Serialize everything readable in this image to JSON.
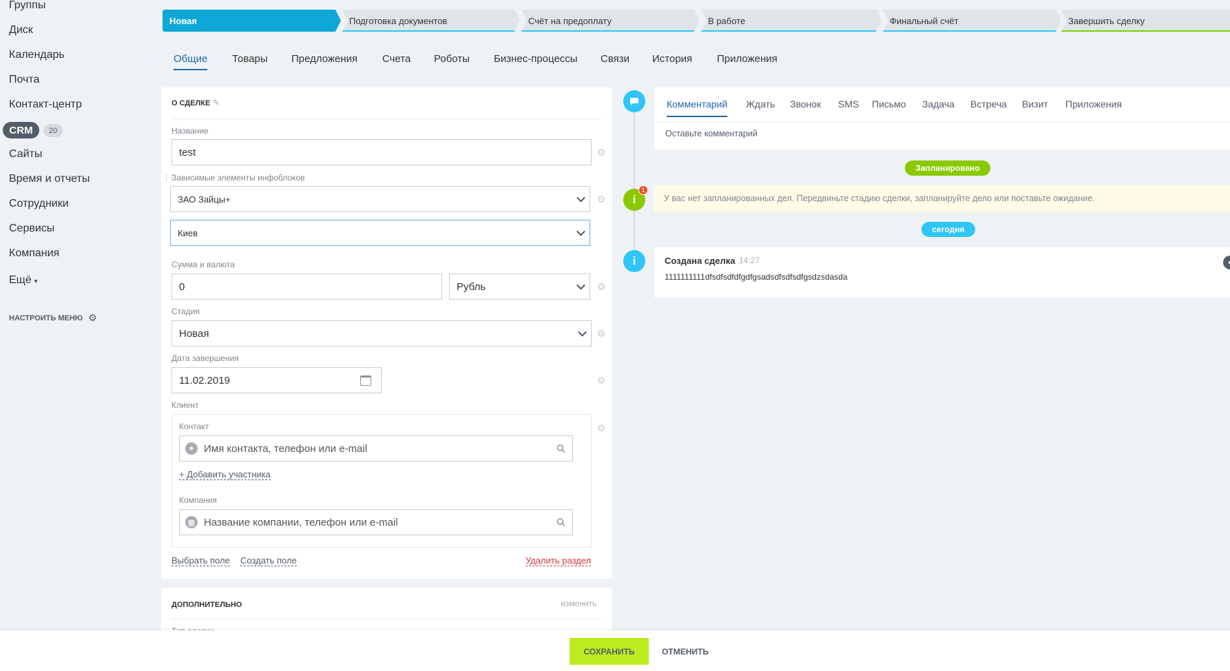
{
  "leftmenu": {
    "items": [
      "Группы",
      "Диск",
      "Календарь",
      "Почта",
      "Контакт-центр",
      "CRM",
      "Сайты",
      "Время и отчеты",
      "Сотрудники",
      "Сервисы",
      "Компания",
      "Ещё"
    ],
    "crm_count": "20",
    "configure_label": "НАСТРОИТЬ МЕНЮ"
  },
  "stages": [
    "Новая",
    "Подготовка документов",
    "Счёт на предоплату",
    "В работе",
    "Финальный счёт",
    "Завершить сделку"
  ],
  "tabs": [
    "Общие",
    "Товары",
    "Предложения",
    "Счета",
    "Роботы",
    "Бизнес-процессы",
    "Связи",
    "История",
    "Приложения"
  ],
  "about": {
    "section_title": "О СДЕЛКЕ",
    "name_label": "Название",
    "name_value": "test",
    "iblock_label": "Зависимые элементы инфоблоков",
    "iblock_value1": "ЗАО Зайцы+",
    "iblock_value2": "Киев",
    "sum_label": "Сумма и валюта",
    "sum_value": "0",
    "currency_value": "Рубль",
    "stage_label": "Стадия",
    "stage_value": "Новая",
    "date_label": "Дата завершения",
    "date_value": "11.02.2019",
    "client_label": "Клиент",
    "contact_label": "Контакт",
    "contact_placeholder": "Имя контакта, телефон или e-mail",
    "add_participant": "+ Добавить участника",
    "company_label": "Компания",
    "company_placeholder": "Название компании, телефон или e-mail",
    "select_field": "Выбрать поле",
    "create_field": "Создать поле",
    "delete_section": "Удалить раздел"
  },
  "additional": {
    "title": "ДОПОЛНИТЕЛЬНО",
    "change_link": "изменить",
    "partial_label": "Тип сделки"
  },
  "timeline": {
    "editor_tabs": [
      "Комментарий",
      "Ждать",
      "Звонок",
      "SMS",
      "Письмо",
      "Задача",
      "Встреча",
      "Визит",
      "Приложения"
    ],
    "comment_placeholder": "Оставьте комментарий",
    "planned_label": "Запланировано",
    "warning_badge": "1",
    "warning_text": "У вас нет запланированных дел. Передвиньте стадию сделки, запланируйте дело или поставьте ожидание.",
    "today_label": "сегодня",
    "entry_title": "Создана сделка",
    "entry_time": "14:27",
    "entry_text": "1111111111dfsdfsdfdfgdfgsadsdfsdfsdfgsdzsdasda"
  },
  "footer": {
    "save_label": "СОХРАНИТЬ",
    "cancel_label": "ОТМЕНИТЬ"
  },
  "colors": {
    "stage_active": "#0fa7d7",
    "link_blue": "#2067b0",
    "save_green": "#bbed21",
    "planned_green": "#8ac800",
    "today_blue": "#2fc6f6"
  }
}
